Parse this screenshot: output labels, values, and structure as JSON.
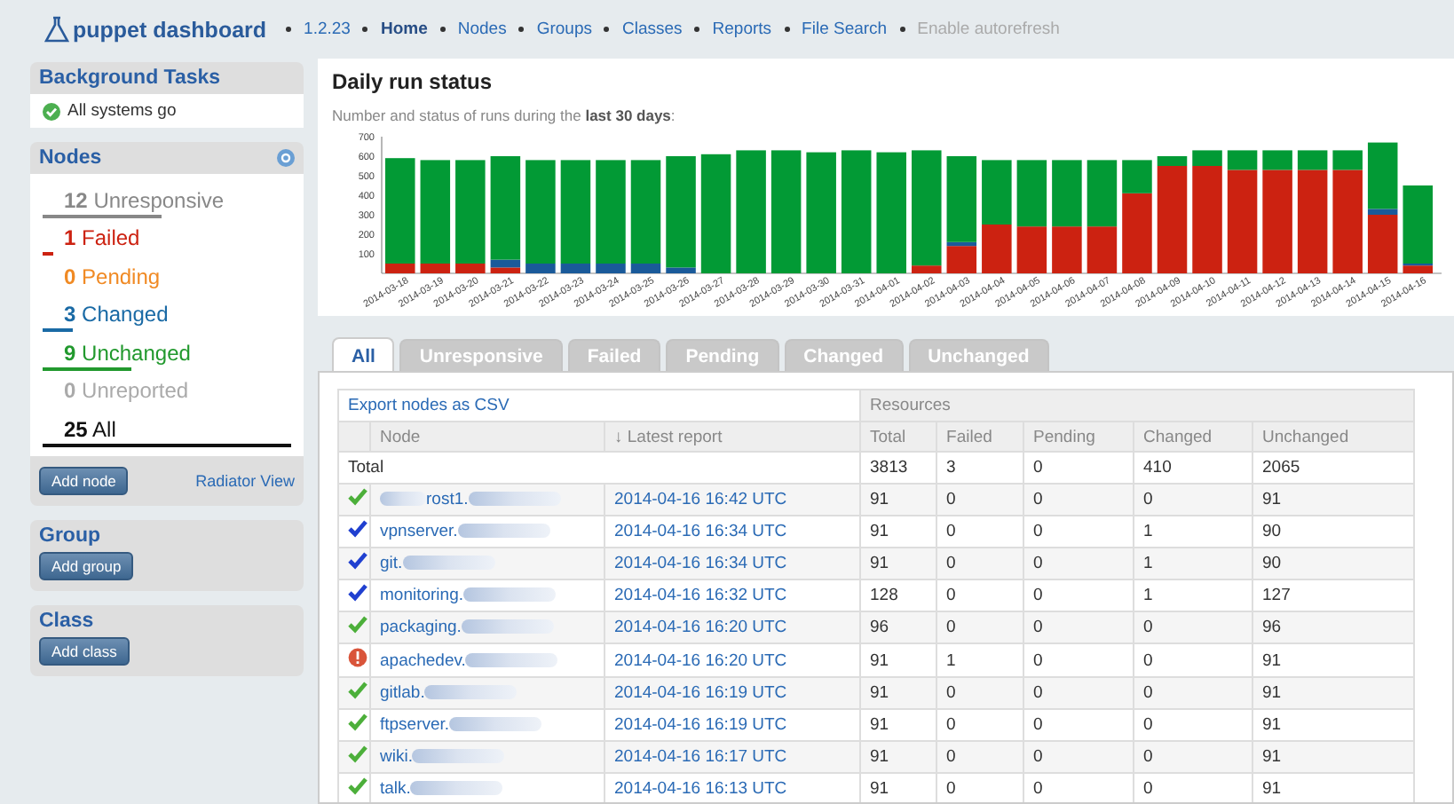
{
  "header": {
    "logo_text": "puppet dashboard",
    "version": "1.2.23",
    "nav": [
      {
        "label": "Home",
        "selected": true,
        "disabled": false
      },
      {
        "label": "Nodes",
        "selected": false,
        "disabled": false
      },
      {
        "label": "Groups",
        "selected": false,
        "disabled": false
      },
      {
        "label": "Classes",
        "selected": false,
        "disabled": false
      },
      {
        "label": "Reports",
        "selected": false,
        "disabled": false
      },
      {
        "label": "File Search",
        "selected": false,
        "disabled": false
      },
      {
        "label": "Enable autorefresh",
        "selected": false,
        "disabled": true
      }
    ]
  },
  "sidebar": {
    "background_tasks": {
      "title": "Background Tasks",
      "status": "All systems go"
    },
    "nodes": {
      "title": "Nodes",
      "stats": [
        {
          "kind": "unresponsive",
          "count": "12",
          "label": "Unresponsive"
        },
        {
          "kind": "failed",
          "count": "1",
          "label": "Failed"
        },
        {
          "kind": "pending",
          "count": "0",
          "label": "Pending"
        },
        {
          "kind": "changed",
          "count": "3",
          "label": "Changed"
        },
        {
          "kind": "unchanged",
          "count": "9",
          "label": "Unchanged"
        },
        {
          "kind": "unreported",
          "count": "0",
          "label": "Unreported"
        },
        {
          "kind": "all",
          "count": "25",
          "label": "All"
        }
      ],
      "add_button": "Add node",
      "radiator_link": "Radiator View"
    },
    "group": {
      "title": "Group",
      "button": "Add group"
    },
    "class": {
      "title": "Class",
      "button": "Add class"
    }
  },
  "chart": {
    "title": "Daily run status",
    "subtitle": "Number and status of runs during the **last 30 days**:",
    "chart_data": {
      "type": "bar",
      "stacked": true,
      "categories": [
        "2014-03-18",
        "2014-03-19",
        "2014-03-20",
        "2014-03-21",
        "2014-03-22",
        "2014-03-23",
        "2014-03-24",
        "2014-03-25",
        "2014-03-26",
        "2014-03-27",
        "2014-03-28",
        "2014-03-29",
        "2014-03-30",
        "2014-03-31",
        "2014-04-01",
        "2014-04-02",
        "2014-04-03",
        "2014-04-04",
        "2014-04-05",
        "2014-04-06",
        "2014-04-07",
        "2014-04-08",
        "2014-04-09",
        "2014-04-10",
        "2014-04-11",
        "2014-04-12",
        "2014-04-13",
        "2014-04-14",
        "2014-04-15",
        "2014-04-16"
      ],
      "series": [
        {
          "color": "#cc2211",
          "values": [
            50,
            50,
            50,
            30,
            0,
            0,
            0,
            0,
            0,
            0,
            0,
            0,
            0,
            0,
            0,
            40,
            140,
            250,
            240,
            240,
            240,
            410,
            550,
            550,
            530,
            530,
            530,
            530,
            300,
            40
          ]
        },
        {
          "color": "#1a5a9a",
          "values": [
            0,
            0,
            0,
            40,
            50,
            50,
            50,
            50,
            30,
            0,
            0,
            0,
            0,
            0,
            0,
            0,
            20,
            0,
            0,
            0,
            0,
            0,
            0,
            0,
            0,
            0,
            0,
            0,
            30,
            10
          ]
        },
        {
          "color": "#029a35",
          "values": [
            540,
            530,
            530,
            530,
            530,
            530,
            530,
            530,
            570,
            610,
            630,
            630,
            620,
            630,
            620,
            590,
            440,
            330,
            340,
            340,
            340,
            170,
            50,
            80,
            100,
            100,
            100,
            100,
            340,
            400
          ]
        }
      ],
      "ylim": [
        0,
        700
      ],
      "yticks": [
        100,
        200,
        300,
        400,
        500,
        600,
        700
      ]
    }
  },
  "tabs": [
    {
      "label": "All",
      "selected": true
    },
    {
      "label": "Unresponsive",
      "selected": false
    },
    {
      "label": "Failed",
      "selected": false
    },
    {
      "label": "Pending",
      "selected": false
    },
    {
      "label": "Changed",
      "selected": false
    },
    {
      "label": "Unchanged",
      "selected": false
    }
  ],
  "table": {
    "export_link": "Export nodes as CSV",
    "resources_label": "Resources",
    "columns": [
      "Node",
      "↓ Latest report",
      "Total",
      "Failed",
      "Pending",
      "Changed",
      "Unchanged"
    ],
    "total_row": {
      "label": "Total",
      "values": [
        "3813",
        "3",
        "0",
        "410",
        "2065"
      ]
    },
    "rows": [
      {
        "kind": "unchanged",
        "node": "rost1.",
        "blur_before": true,
        "latest_report": "2014-04-16 16:42 UTC",
        "values": [
          "91",
          "0",
          "0",
          "0",
          "91"
        ]
      },
      {
        "kind": "changed",
        "node": "vpnserver.",
        "blur_before": false,
        "latest_report": "2014-04-16 16:34 UTC",
        "values": [
          "91",
          "0",
          "0",
          "1",
          "90"
        ]
      },
      {
        "kind": "changed",
        "node": "git.",
        "blur_before": false,
        "latest_report": "2014-04-16 16:34 UTC",
        "values": [
          "91",
          "0",
          "0",
          "1",
          "90"
        ]
      },
      {
        "kind": "changed",
        "node": "monitoring.",
        "blur_before": false,
        "latest_report": "2014-04-16 16:32 UTC",
        "values": [
          "128",
          "0",
          "0",
          "1",
          "127"
        ]
      },
      {
        "kind": "unchanged",
        "node": "packaging.",
        "blur_before": false,
        "latest_report": "2014-04-16 16:20 UTC",
        "values": [
          "96",
          "0",
          "0",
          "0",
          "96"
        ]
      },
      {
        "kind": "failed",
        "node": "apachedev.",
        "blur_before": false,
        "latest_report": "2014-04-16 16:20 UTC",
        "values": [
          "91",
          "1",
          "0",
          "0",
          "91"
        ]
      },
      {
        "kind": "unchanged",
        "node": "gitlab.",
        "blur_before": false,
        "latest_report": "2014-04-16 16:19 UTC",
        "values": [
          "91",
          "0",
          "0",
          "0",
          "91"
        ]
      },
      {
        "kind": "unchanged",
        "node": "ftpserver.",
        "blur_before": false,
        "latest_report": "2014-04-16 16:19 UTC",
        "values": [
          "91",
          "0",
          "0",
          "0",
          "91"
        ]
      },
      {
        "kind": "unchanged",
        "node": "wiki.",
        "blur_before": false,
        "latest_report": "2014-04-16 16:17 UTC",
        "values": [
          "91",
          "0",
          "0",
          "0",
          "91"
        ]
      },
      {
        "kind": "unchanged",
        "node": "talk.",
        "blur_before": false,
        "latest_report": "2014-04-16 16:13 UTC",
        "values": [
          "91",
          "0",
          "0",
          "0",
          "91"
        ]
      }
    ]
  }
}
